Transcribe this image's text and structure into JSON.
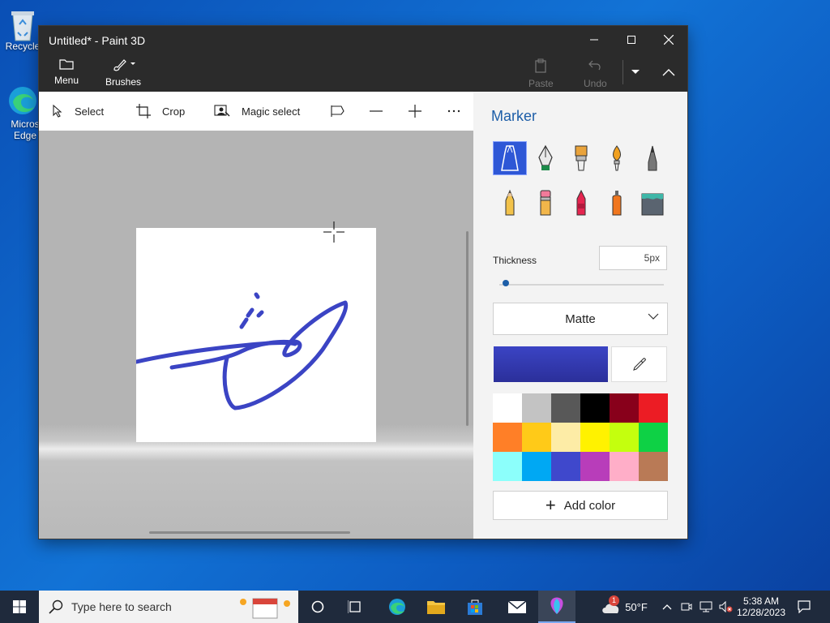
{
  "desktop": {
    "icons": [
      {
        "label": "Recycle"
      },
      {
        "label": "Micros Edge"
      }
    ]
  },
  "window": {
    "title": "Untitled* - Paint 3D",
    "ribbon": {
      "menu_label": "Menu",
      "brushes_label": "Brushes",
      "paste_label": "Paste",
      "undo_label": "Undo"
    },
    "toolbar": {
      "select_label": "Select",
      "crop_label": "Crop",
      "magic_select_label": "Magic select"
    }
  },
  "panel": {
    "title": "Marker",
    "thickness_label": "Thickness",
    "thickness_value": "5px",
    "thickness_level": 0.02,
    "finish_value": "Matte",
    "current_color": "#3b44c4",
    "palette": [
      "#ffffff",
      "#c3c3c3",
      "#585858",
      "#000000",
      "#88001b",
      "#ec1c24",
      "#ff7f27",
      "#ffca18",
      "#fdeca6",
      "#fff200",
      "#c4ff0e",
      "#0ed145",
      "#8cfffb",
      "#00a8f3",
      "#3f48cc",
      "#b83dba",
      "#ffaec8",
      "#b97a56"
    ],
    "add_color_label": "Add color"
  },
  "taskbar": {
    "search_placeholder": "Type here to search",
    "weather_temp": "50°F",
    "weather_badge": "1",
    "time": "5:38 AM",
    "date": "12/28/2023"
  }
}
